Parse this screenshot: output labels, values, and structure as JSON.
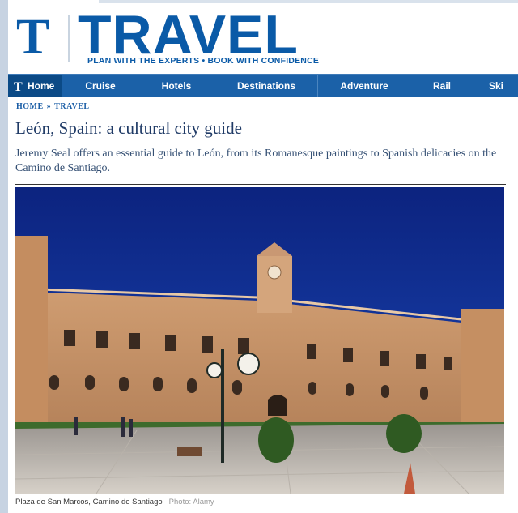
{
  "masthead": {
    "logo_letter": "T",
    "section": "TRAVEL",
    "tagline": "PLAN WITH THE EXPERTS • BOOK WITH CONFIDENCE"
  },
  "nav": {
    "items": [
      {
        "label": "Home"
      },
      {
        "label": "Cruise"
      },
      {
        "label": "Hotels"
      },
      {
        "label": "Destinations"
      },
      {
        "label": "Adventure"
      },
      {
        "label": "Rail"
      },
      {
        "label": "Ski"
      }
    ]
  },
  "breadcrumb": {
    "items": [
      "HOME",
      "TRAVEL"
    ],
    "separator": "»"
  },
  "article": {
    "headline": "León, Spain: a cultural city guide",
    "standfirst": "Jeremy Seal offers an essential guide to León, from its Romanesque paintings to Spanish delicacies on the Camino de Santiago.",
    "caption": "Plaza de San Marcos, Camino de Santiago",
    "credit": "Photo: Alamy"
  },
  "colors": {
    "brand_blue": "#0a5aa7",
    "nav_blue": "#1b61a8",
    "nav_active": "#0b4a86",
    "sky": "#13339c",
    "stone": "#c9966a"
  }
}
